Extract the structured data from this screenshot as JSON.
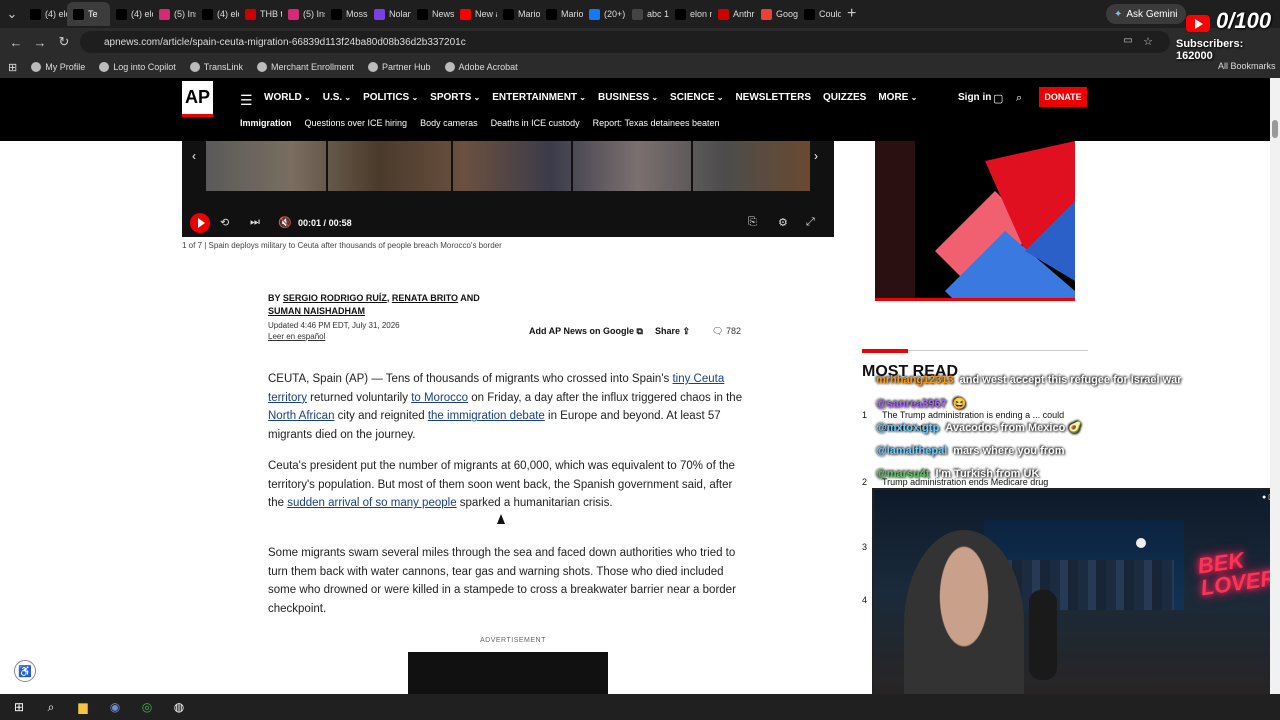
{
  "browser": {
    "tabs": [
      {
        "label": "(4) elo",
        "icon": "x-icon",
        "color": "#000000"
      },
      {
        "label": "Te",
        "icon": "ap-icon",
        "color": "#000000",
        "active": true
      },
      {
        "label": "(4) elo",
        "icon": "x-icon",
        "color": "#000000"
      },
      {
        "label": "(5) Ins",
        "icon": "instagram-icon",
        "color": "#d62976"
      },
      {
        "label": "(4) elo",
        "icon": "x-icon",
        "color": "#000000"
      },
      {
        "label": "THB tl",
        "icon": "tab-icon",
        "color": "#cc0000"
      },
      {
        "label": "(5) Ins",
        "icon": "instagram-icon",
        "color": "#d62976"
      },
      {
        "label": "Mossa",
        "icon": "x-icon",
        "color": "#000000"
      },
      {
        "label": "Nolan",
        "icon": "tab-icon",
        "color": "#7b3fe4"
      },
      {
        "label": "News",
        "icon": "ap-icon",
        "color": "#000000"
      },
      {
        "label": "New a",
        "icon": "youtube-icon",
        "color": "#ff0000"
      },
      {
        "label": "Mario",
        "icon": "x-icon",
        "color": "#000000"
      },
      {
        "label": "Mario",
        "icon": "x-icon",
        "color": "#000000"
      },
      {
        "label": "(20+)",
        "icon": "facebook-icon",
        "color": "#1877f2"
      },
      {
        "label": "abc 1",
        "icon": "google-icon",
        "color": "#444444"
      },
      {
        "label": "elon n",
        "icon": "x-icon",
        "color": "#000000"
      },
      {
        "label": "Anthr",
        "icon": "cnn-icon",
        "color": "#cc0000"
      },
      {
        "label": "Googl",
        "icon": "google-icon",
        "color": "#ea4335"
      },
      {
        "label": "Could",
        "icon": "x-icon",
        "color": "#000000"
      }
    ],
    "new_tab": "+",
    "gemini_label": "Ask Gemini",
    "url": "apnews.com/article/spain-ceuta-migration-66839d113f24ba80d08b36d2b337201c",
    "bookmarks": [
      "My Profile",
      "Log into Copilot",
      "TransLink",
      "Merchant Enrollment",
      "Partner Hub",
      "Adobe Acrobat"
    ],
    "all_bookmarks": "All Bookmarks"
  },
  "stream": {
    "counter": "0/100",
    "subscribers": "Subscribers: 162000",
    "chat": [
      {
        "user": "mrhhang12313",
        "text": "and west accept this refugee for Israel war",
        "color": "orange"
      },
      {
        "user": "@sanrea3967",
        "text": "😆",
        "color": "purple"
      },
      {
        "user": "@mxtox.gtp",
        "text": "Avacodos from Mexico 🥑",
        "color": "user"
      },
      {
        "user": "@lamalthepal",
        "text": "mars where you from",
        "color": "user"
      },
      {
        "user": "@marsu4t",
        "text": "I'm Turkish from UK",
        "color": "green"
      }
    ],
    "neon_sign": "BEK LOVER"
  },
  "ap": {
    "logo": "AP",
    "nav": [
      "WORLD",
      "U.S.",
      "POLITICS",
      "SPORTS",
      "ENTERTAINMENT",
      "BUSINESS",
      "SCIENCE",
      "NEWSLETTERS",
      "QUIZZES",
      "MORE"
    ],
    "signin": "Sign in",
    "donate": "DONATE",
    "subnav": [
      "Immigration",
      "Questions over ICE hiring",
      "Body cameras",
      "Deaths in ICE custody",
      "Report: Texas detainees beaten"
    ]
  },
  "video": {
    "time_current": "00:01",
    "time_sep": "/",
    "time_total": "00:58",
    "caption": "1 of 7 | Spain deploys military to Ceuta after thousands of people breach Morocco's border"
  },
  "article": {
    "byline_prefix": "BY",
    "authors": [
      "SERGIO RODRIGO RUÍZ",
      "RENATA BRITO",
      "SUMAN NAISHADHAM"
    ],
    "and_word": "AND",
    "updated": "Updated 4:46 PM EDT, July 31, 2026",
    "espanol": "Leer en español",
    "add_ap": "Add AP News on Google",
    "share": "Share",
    "comments": "782",
    "p1": {
      "t1": "CEUTA, Spain (AP) — Tens of thousands of migrants who crossed into Spain's ",
      "l1": "tiny Ceuta territory",
      "t2": " returned voluntarily ",
      "l2": "to Morocco",
      "t3": " on Friday, a day after the influx triggered chaos in the ",
      "l3": "North African",
      "t4": " city and reignited ",
      "l4": "the immigration debate",
      "t5": " in Europe and beyond. At least 57 migrants died on the journey."
    },
    "p2": {
      "t1": "Ceuta's president put the number of migrants at 60,000, which was equivalent to 70% of the territory's population. But most of them soon went back, the Spanish government said, after the ",
      "l1": "sudden arrival of so many people",
      "t2": " sparked a humanitarian crisis."
    },
    "p3": "Some migrants swam several miles through the sea and faced down authorities who tried to turn them back with water cannons, tear gas and warning shots. Those who died included some who drowned or were killed in a stampede to cross a breakwater barrier near a border checkpoint.",
    "ad_label": "ADVERTISEMENT"
  },
  "most_read": {
    "title": "MOST READ",
    "items": [
      {
        "num": "1",
        "text": "The Trump administration is ending a ... could affect costs"
      },
      {
        "num": "2",
        "text": "Trump administration ends Medicare drug"
      },
      {
        "num": "3",
        "text": ""
      },
      {
        "num": "4",
        "text": ""
      }
    ]
  },
  "colors": {
    "ap_red": "#e00000",
    "link": "#1a3f8a",
    "header_bg": "#000000"
  }
}
